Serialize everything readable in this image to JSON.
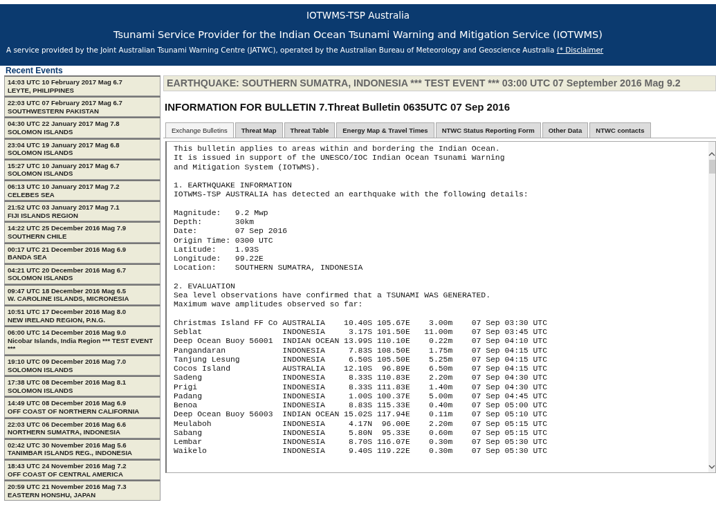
{
  "header": {
    "title": "IOTWMS-TSP Australia",
    "subtitle": "Tsunami Service Provider for the Indian Ocean Tsunami Warning and Mitigation Service (IOTWMS)",
    "service_note": "A service provided by the Joint Australian Tsunami Warning Centre (JATWC), operated by the Australian Bureau of Meteorology and Geoscience Australia",
    "disclaimer_link": "(* Disclaimer"
  },
  "sidebar": {
    "title": "Recent Events",
    "items": [
      {
        "when": "14:03 UTC 10 February 2017 Mag 6.7",
        "region": "LEYTE, PHILIPPINES"
      },
      {
        "when": "22:03 UTC 07 February 2017 Mag 6.7",
        "region": "SOUTHWESTERN PAKISTAN"
      },
      {
        "when": "04:30 UTC 22 January 2017 Mag 7.8",
        "region": "SOLOMON ISLANDS"
      },
      {
        "when": "23:04 UTC 19 January 2017 Mag 6.8",
        "region": "SOLOMON ISLANDS"
      },
      {
        "when": "15:27 UTC 10 January 2017 Mag 6.7",
        "region": "SOLOMON ISLANDS"
      },
      {
        "when": "06:13 UTC 10 January 2017 Mag 7.2",
        "region": "CELEBES SEA"
      },
      {
        "when": "21:52 UTC 03 January 2017 Mag 7.1",
        "region": "FIJI ISLANDS REGION"
      },
      {
        "when": "14:22 UTC 25 December 2016 Mag 7.9",
        "region": "SOUTHERN CHILE"
      },
      {
        "when": "00:17 UTC 21 December 2016 Mag 6.9",
        "region": "BANDA SEA"
      },
      {
        "when": "04:21 UTC 20 December 2016 Mag 6.7",
        "region": "SOLOMON ISLANDS"
      },
      {
        "when": "09:47 UTC 18 December 2016 Mag 6.5",
        "region": "W. CAROLINE ISLANDS, MICRONESIA"
      },
      {
        "when": "10:51 UTC 17 December 2016 Mag 8.0",
        "region": "NEW IRELAND REGION, P.N.G."
      },
      {
        "when": "06:00 UTC 14 December 2016 Mag 9.0",
        "region": "Nicobar Islands, India Region *** TEST EVENT ***"
      },
      {
        "when": "19:10 UTC 09 December 2016 Mag 7.0",
        "region": "SOLOMON ISLANDS"
      },
      {
        "when": "17:38 UTC 08 December 2016 Mag 8.1",
        "region": "SOLOMON ISLANDS"
      },
      {
        "when": "14:49 UTC 08 December 2016 Mag 6.9",
        "region": "OFF COAST OF NORTHERN CALIFORNIA"
      },
      {
        "when": "22:03 UTC 06 December 2016 Mag 6.6",
        "region": "NORTHERN SUMATRA, INDONESIA"
      },
      {
        "when": "02:42 UTC 30 November 2016 Mag 5.6",
        "region": "TANIMBAR ISLANDS REG., INDONESIA"
      },
      {
        "when": "18:43 UTC 24 November 2016 Mag 7.2",
        "region": "OFF COAST OF CENTRAL AMERICA"
      },
      {
        "when": "20:59 UTC 21 November 2016 Mag 7.3",
        "region": "EASTERN HONSHU, JAPAN"
      }
    ]
  },
  "event_title": "EARTHQUAKE: SOUTHERN SUMATRA, INDONESIA *** TEST EVENT *** 03:00 UTC 07 September 2016 Mag 9.2",
  "bulletin_heading": "INFORMATION FOR BULLETIN 7.Threat Bulletin 0635UTC 07 Sep 2016",
  "tabs": [
    {
      "label": "Exchange Bulletins",
      "selected": true
    },
    {
      "label": "Threat Map",
      "selected": false
    },
    {
      "label": "Threat Table",
      "selected": false
    },
    {
      "label": "Energy Map & Travel Times",
      "selected": false
    },
    {
      "label": "NTWC Status Reporting Form",
      "selected": false
    },
    {
      "label": "Other Data",
      "selected": false
    },
    {
      "label": "NTWC contacts",
      "selected": false
    }
  ],
  "bulletin_blocks": [
    "This bulletin applies to areas within and bordering the Indian Ocean.\nIt is issued in support of the UNESCO/IOC Indian Ocean Tsunami Warning\nand Mitigation System (IOTWMS).",
    "1. EARTHQUAKE INFORMATION\nIOTWMS-TSP AUSTRALIA has detected an earthquake with the following details:",
    "Magnitude:   9.2 Mwp\nDepth:       30km\nDate:        07 Sep 2016\nOrigin Time: 0300 UTC\nLatitude:    1.93S\nLongitude:   99.22E\nLocation:    SOUTHERN SUMATRA, INDONESIA",
    "2. EVALUATION\nSea level observations have confirmed that a TSUNAMI WAS GENERATED.\nMaximum wave amplitudes observed so far:",
    "Christmas Island FF Co AUSTRALIA    10.40S 105.67E    3.00m    07 Sep 03:30 UTC\nSeblat                 INDONESIA     3.17S 101.50E   11.00m    07 Sep 03:45 UTC\nDeep Ocean Buoy 56001  INDIAN OCEAN 13.99S 110.10E    0.22m    07 Sep 04:10 UTC\nPangandaran            INDONESIA     7.83S 108.50E    1.75m    07 Sep 04:15 UTC\nTanjung Lesung         INDONESIA     6.50S 105.50E    5.25m    07 Sep 04:15 UTC\nCocos Island           AUSTRALIA    12.10S  96.89E    6.50m    07 Sep 04:15 UTC\nSadeng                 INDONESIA     8.33S 110.83E    2.20m    07 Sep 04:30 UTC\nPrigi                  INDONESIA     8.33S 111.83E    1.40m    07 Sep 04:30 UTC\nPadang                 INDONESIA     1.00S 100.37E    5.00m    07 Sep 04:45 UTC\nBenoa                  INDONESIA     8.83S 115.33E    0.40m    07 Sep 05:00 UTC\nDeep Ocean Buoy 56003  INDIAN OCEAN 15.02S 117.94E    0.11m    07 Sep 05:10 UTC\nMeulaboh               INDONESIA     4.17N  96.00E    2.20m    07 Sep 05:15 UTC\nSabang                 INDONESIA     5.80N  95.33E    0.60m    07 Sep 05:15 UTC\nLembar                 INDONESIA     8.70S 116.07E    0.30m    07 Sep 05:30 UTC\nWaikelo                INDONESIA     9.40S 119.22E    0.30m    07 Sep 05:30 UTC"
  ]
}
